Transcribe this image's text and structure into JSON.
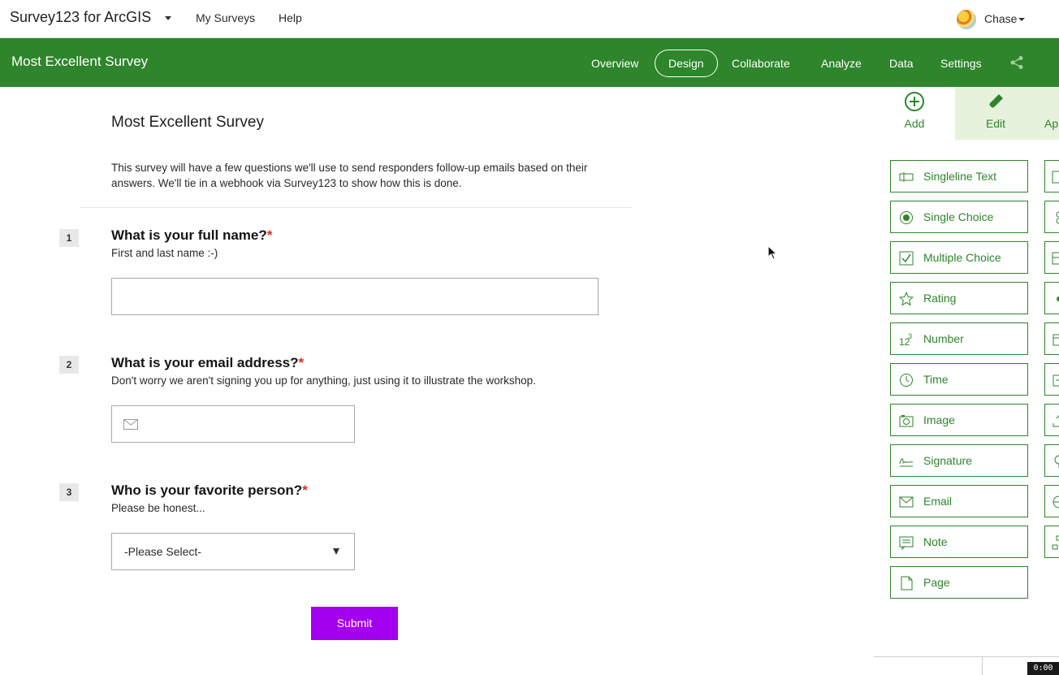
{
  "topbar": {
    "app_title": "Survey123 for ArcGIS",
    "links": [
      "My Surveys",
      "Help"
    ],
    "user_name": "Chase"
  },
  "header": {
    "survey_title": "Most Excellent Survey",
    "tabs": [
      "Overview",
      "Design",
      "Collaborate",
      "Analyze",
      "Data",
      "Settings"
    ],
    "active_tab": "Design"
  },
  "form": {
    "title": "Most Excellent Survey",
    "description": "This survey will have a few questions we'll use to send responders follow-up emails based on their answers.  We'll tie in a webhook via Survey123 to show how this is done.",
    "questions": [
      {
        "number": "1",
        "title": "What is your full name?",
        "required": "*",
        "hint": "First and last name :-)"
      },
      {
        "number": "2",
        "title": "What is your email address?",
        "required": "*",
        "hint": "Don't worry we aren't signing you up for anything, just using it to illustrate the workshop."
      },
      {
        "number": "3",
        "title": "Who is your favorite person?",
        "required": "*",
        "hint": "Please be honest...",
        "select_value": "-Please Select-"
      }
    ],
    "submit_label": "Submit"
  },
  "panel": {
    "tabs": {
      "add": "Add",
      "edit": "Edit",
      "appearance": "Ap"
    },
    "question_types": [
      {
        "label": "Singleline Text",
        "icon": "singleline-text-icon"
      },
      {
        "label": "Single Choice",
        "icon": "radio-icon"
      },
      {
        "label": "Multiple Choice",
        "icon": "checkbox-icon"
      },
      {
        "label": "Rating",
        "icon": "star-icon"
      },
      {
        "label": "Number",
        "icon": "number-icon"
      },
      {
        "label": "Time",
        "icon": "clock-icon"
      },
      {
        "label": "Image",
        "icon": "camera-icon"
      },
      {
        "label": "Signature",
        "icon": "signature-icon"
      },
      {
        "label": "Email",
        "icon": "mail-icon"
      },
      {
        "label": "Note",
        "icon": "note-icon"
      },
      {
        "label": "Page",
        "icon": "page-icon"
      }
    ]
  },
  "recorder": {
    "timer": "0:00"
  },
  "colors": {
    "brand_green": "#2e852b",
    "submit_purple": "#a400f0",
    "required_red": "#d83020"
  }
}
